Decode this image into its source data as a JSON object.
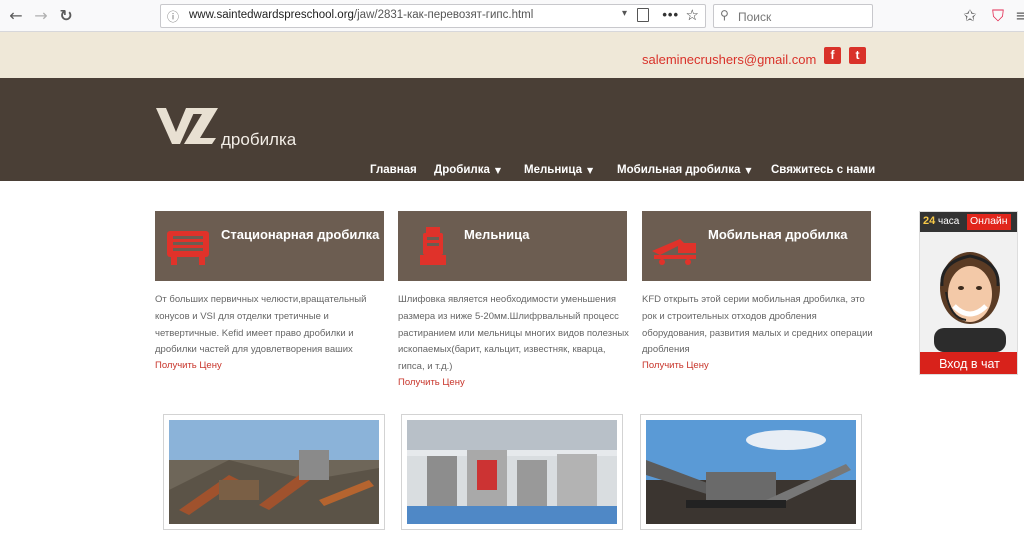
{
  "browser": {
    "url_host": "www.saintedwardspreschool.org",
    "url_path": "/jaw/2831-как-перевозят-гипс.html",
    "search_placeholder": "Поиск"
  },
  "topbar": {
    "email": "saleminecrushers@gmail.com",
    "social": [
      "f",
      "t"
    ]
  },
  "header": {
    "logo_text": "дробилка",
    "nav": [
      {
        "label": "Главная"
      },
      {
        "label": "Дробилка"
      },
      {
        "label": "Мельница"
      },
      {
        "label": "Мобильная дробилка"
      },
      {
        "label": "Свяжитесь с нами"
      }
    ]
  },
  "features": [
    {
      "title": "Стационарная дробилка",
      "description": [
        "От больших первичных челюсти,вращательный",
        "конусов и VSI для отделки третичные и",
        "четвертичные. Kefid имеет право дробилки и",
        "дробилки частей для удовлетворения ваших"
      ],
      "more": "Получить Цену"
    },
    {
      "title": "Мельница",
      "description": [
        "Шлифовка является необходимости уменьшения",
        "размера из ниже 5-20мм.Шлифрвальный процесс",
        "растиранием или мельницы многих видов полезных",
        "ископаемых(барит, кальцит, известняк, кварца,",
        "гипса, и т.д.)"
      ],
      "more": "Получить Цену"
    },
    {
      "title": "Мобильная дробилка",
      "description": [
        "KFD открыть этой серии мобильная дробилка, это",
        "рок и строительных отходов дробления",
        "оборудования, развития малых и средних операции",
        "дробления"
      ],
      "more": "Получить Цену"
    }
  ],
  "chat": {
    "hours_num": "24",
    "hours_label": "часа",
    "online": "Онлайн",
    "button": "Вход в чат"
  },
  "colors": {
    "accent": "#d9322a",
    "header_bg": "#4a3f36",
    "card_bg": "#6c5d51",
    "topbar_bg": "#efe8d8"
  }
}
